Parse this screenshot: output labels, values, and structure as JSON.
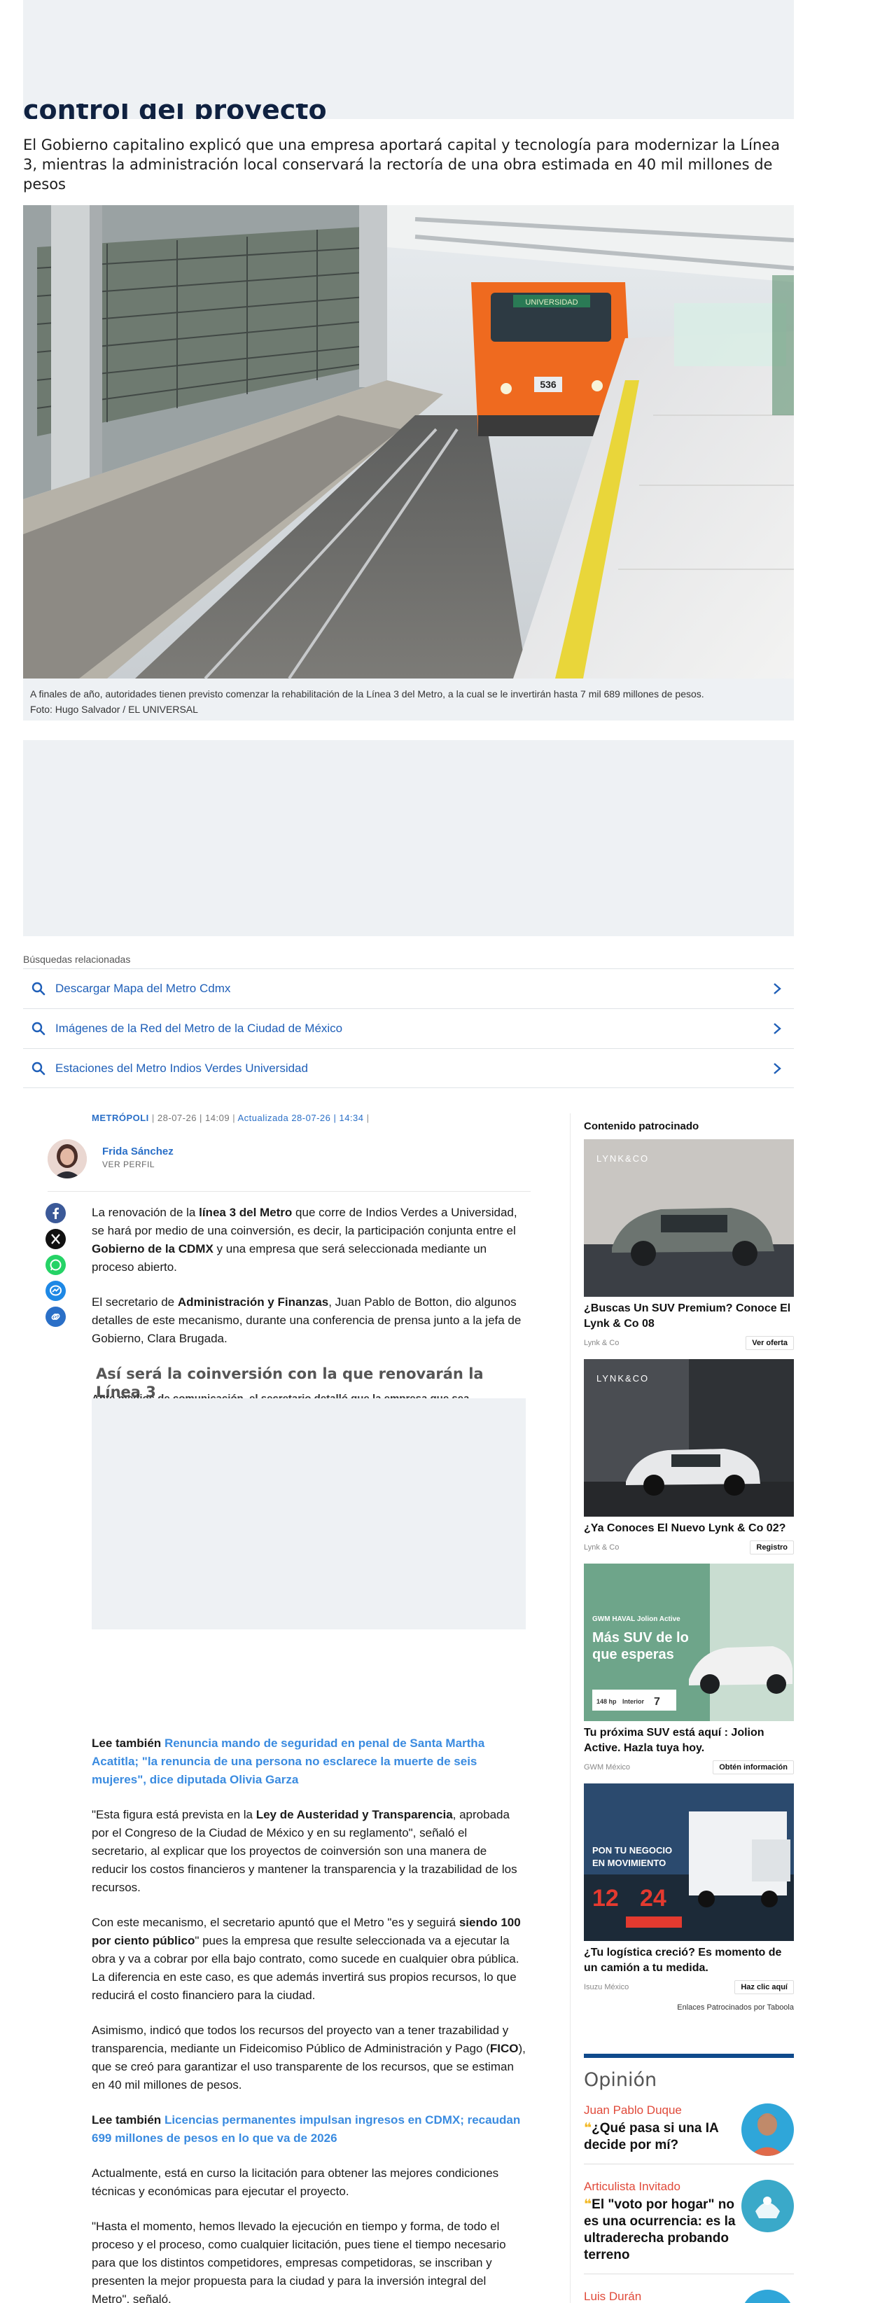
{
  "header": {
    "title_peek": "control del proyecto",
    "subtitle": "El Gobierno capitalino explicó que una empresa aportará capital y tecnología para modernizar la Línea 3, mientras la administración local conservará la rectoría de una obra estimada en 40 mil millones de pesos"
  },
  "hero": {
    "train_sign": "UNIVERSIDAD",
    "train_number": "536",
    "caption": "A finales de año, autoridades tienen previsto comenzar la rehabilitación de la Línea 3 del Metro, a la cual se le invertirán hasta 7 mil 689 millones de pesos.",
    "credit": "Foto: Hugo Salvador / EL UNIVERSAL"
  },
  "related": {
    "title": "Búsquedas relacionadas",
    "items": [
      {
        "label": "Descargar Mapa del Metro Cdmx"
      },
      {
        "label": "Imágenes de la Red del Metro de la Ciudad de México"
      },
      {
        "label": "Estaciones del Metro Indios Verdes Universidad"
      }
    ]
  },
  "meta": {
    "section": "METRÓPOLI",
    "published": "28-07-26 | 14:09",
    "updated_label": "Actualizada",
    "updated": "28-07-26 | 14:34"
  },
  "author": {
    "name": "Frida Sánchez",
    "profile_link": "VER PERFIL"
  },
  "share": {
    "icons": [
      "facebook-icon",
      "x-icon",
      "whatsapp-icon",
      "messenger-icon",
      "link-icon"
    ],
    "colors": {
      "facebook": "#3b5998",
      "x": "#111111",
      "whatsapp": "#25d366",
      "messenger": "#1e88e5",
      "link": "#2a6fc7"
    }
  },
  "article": {
    "p1_a": "La renovación de la ",
    "p1_b": "línea 3 del Metro",
    "p1_c": " que corre de Indios Verdes a Universidad, se hará por medio de una coinversión, es decir, la participación conjunta entre el ",
    "p1_d": "Gobierno de la CDMX",
    "p1_e": " y una empresa que será seleccionada mediante un proceso abierto.",
    "p2_a": "El secretario de ",
    "p2_b": "Administración y Finanzas",
    "p2_c": ", Juan Pablo de Botton, dio algunos detalles de este mecanismo, durante una conferencia de prensa junto a la jefa de Gobierno, Clara Brugada.",
    "h2": "Así será la coinversión con la que renovarán la Línea 3",
    "h2_peek": "Ante medios de comunicación, el secretario detalló que la empresa que sea",
    "lee1_label": "Lee también",
    "lee1_link": "Renuncia mando de seguridad en penal de Santa Martha Acatitla; \"la renuncia de una persona no esclarece la muerte de seis mujeres\", dice diputada Olivia Garza",
    "p3_a": "\"Esta figura está prevista en la ",
    "p3_b": "Ley de Austeridad y Transparencia",
    "p3_c": ", aprobada por el Congreso de la Ciudad de México y en su reglamento\", señaló el secretario, al explicar que los proyectos de coinversión son una manera de reducir los costos financieros y mantener la transparencia y la trazabilidad de los recursos.",
    "p4_a": "Con este mecanismo, el secretario apuntó que el Metro \"es y seguirá ",
    "p4_b": "siendo 100 por ciento público",
    "p4_c": "\" pues la empresa que resulte seleccionada va a ejecutar la obra y va a cobrar por ella bajo contrato, como sucede en cualquier obra pública. La diferencia en este caso, es que además invertirá sus propios recursos, lo que reducirá el costo financiero para la ciudad.",
    "p5_a": "Asimismo, indicó que todos los recursos del proyecto van a tener trazabilidad y transparencia, mediante un Fideicomiso Público de Administración y Pago (",
    "p5_b": "FICO",
    "p5_c": "), que se creó para garantizar el uso transparente de los recursos, que se estiman en 40 mil millones de pesos.",
    "lee2_label": "Lee también",
    "lee2_link": "Licencias permanentes impulsan ingresos en CDMX; recaudan 699 millones de pesos en lo que va de 2026",
    "p6": "Actualmente, está en curso la licitación para obtener las mejores condiciones técnicas y económicas para ejecutar el proyecto.",
    "p7": "\"Hasta el momento, hemos llevado la ejecución en tiempo y forma, de todo el proceso y el proceso, como cualquier licitación, pues tiene el tiempo necesario para que los distintos competidores, empresas competidoras, se inscriban y presenten la mejor propuesta para la ciudad y para la inversión integral del Metro\", señaló."
  },
  "sponsored": {
    "title": "Contenido patrocinado",
    "cards": [
      {
        "headline": "¿Buscas Un SUV Premium? Conoce El Lynk & Co 08",
        "source": "Lynk & Co",
        "cta": "Ver oferta",
        "brand": "LYNK&CO"
      },
      {
        "headline": "¿Ya Conoces El Nuevo Lynk & Co 02?",
        "source": "Lynk & Co",
        "cta": "Registro",
        "brand": "LYNK&CO"
      },
      {
        "headline": "Tu próxima SUV está aquí : Jolion Active. Hazla tuya hoy.",
        "source": "GWM México",
        "cta": "Obtén información",
        "ad_title": "GWM HAVAL Jolion Active",
        "ad_text_1": "Más SUV de lo",
        "ad_text_2": "que esperas",
        "ad_spec_1": "148 hp",
        "ad_spec_2": "Interior",
        "ad_spec_3": "7"
      },
      {
        "headline": "¿Tu logística creció? Es momento de un camión a tu medida.",
        "source": "Isuzu México",
        "cta": "Haz clic aquí",
        "ad_line_1": "PON TU NEGOCIO",
        "ad_line_2": "EN MOVIMIENTO",
        "ad_num_1": "12",
        "ad_num_2": "24"
      }
    ],
    "footer": "Enlaces Patrocinados por Taboola"
  },
  "opinion": {
    "title": "Opinión",
    "items": [
      {
        "author": "Juan Pablo Duque",
        "headline": "¿Qué pasa si una IA decide por mí?"
      },
      {
        "author": "Articulista Invitado",
        "headline": "El \"voto por hogar\" no es una ocurrencia: es la ultraderecha probando terreno"
      },
      {
        "author": "Luis Durán",
        "headline": ""
      }
    ]
  }
}
